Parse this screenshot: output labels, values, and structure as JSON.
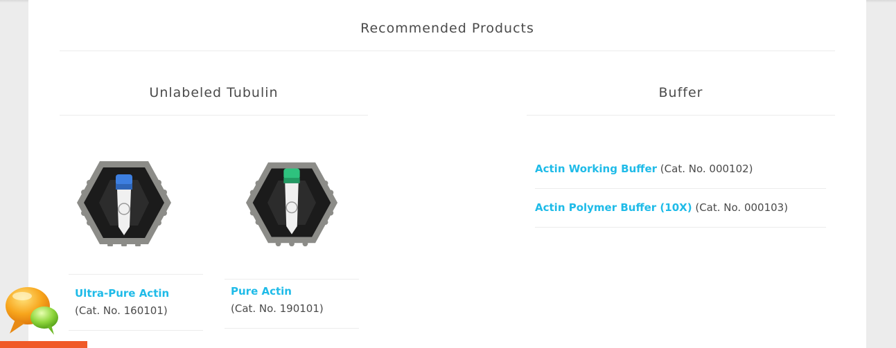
{
  "section": {
    "title": "Recommended Products"
  },
  "columns": {
    "left": {
      "title": "Unlabeled Tubulin",
      "products": [
        {
          "name": "Ultra-Pure Actin",
          "cat": "(Cat. No. 160101)",
          "cap_color": "#3d7fe0"
        },
        {
          "name": "Pure Actin",
          "cat": "(Cat. No. 190101)",
          "cap_color": "#2ec27e"
        }
      ]
    },
    "right": {
      "title": "Buffer",
      "items": [
        {
          "name": "Actin Working Buffer",
          "cat": "(Cat. No. 000102)"
        },
        {
          "name": "Actin Polymer Buffer (10X)",
          "cat": "(Cat. No. 000103)"
        }
      ]
    }
  },
  "colors": {
    "link": "#1fbbe8",
    "text": "#4a4a4a",
    "accent": "#f05a28"
  },
  "icons": {
    "chat": "chat-bubbles-icon",
    "product": "tube-hex-icon"
  }
}
